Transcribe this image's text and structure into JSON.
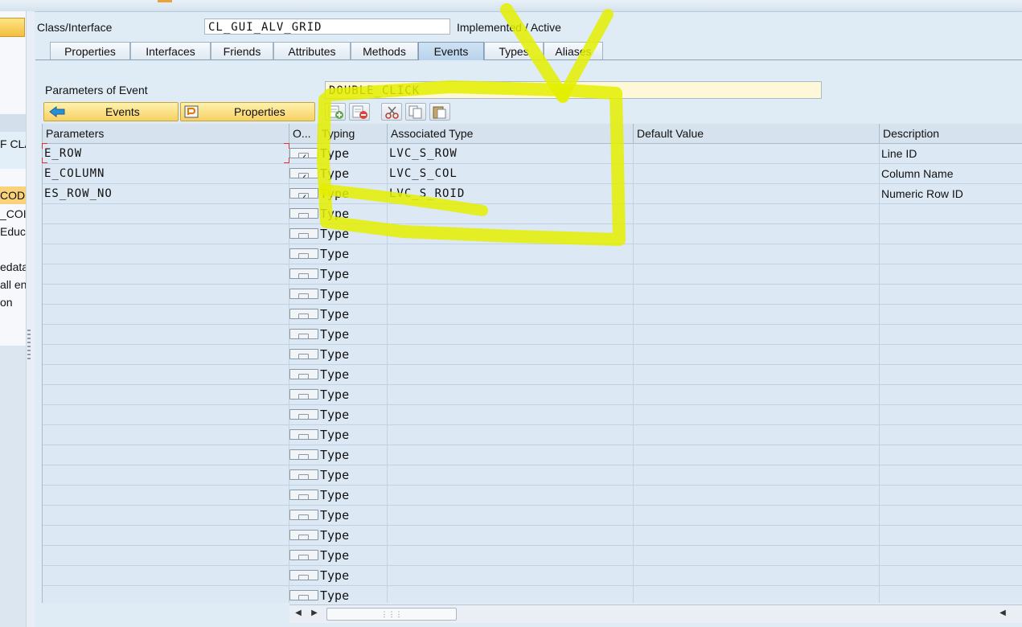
{
  "header": {
    "class_label": "Class/Interface",
    "class_value": "CL_GUI_ALV_GRID",
    "status": "Implemented / Active"
  },
  "left_panel": {
    "rows": [
      "F CLA",
      "CODE",
      "_COI",
      "Educa",
      "edata",
      "all en",
      "on"
    ]
  },
  "tabs": [
    {
      "label": "Properties"
    },
    {
      "label": "Interfaces"
    },
    {
      "label": "Friends"
    },
    {
      "label": "Attributes"
    },
    {
      "label": "Methods"
    },
    {
      "label": "Events"
    },
    {
      "label": "Types"
    },
    {
      "label": "Aliases"
    }
  ],
  "active_tab": "Events",
  "event": {
    "label": "Parameters of Event",
    "value": "DOUBLE_CLICK"
  },
  "toolbar": {
    "events_button": "Events",
    "properties_button": "Properties",
    "icons": [
      "insert-row-icon",
      "delete-row-icon",
      "cut-icon",
      "copy-icon",
      "paste-icon"
    ]
  },
  "grid": {
    "columns": [
      "Parameters",
      "O...",
      "Typing",
      "Associated Type",
      "Default Value",
      "Description"
    ],
    "rows": [
      {
        "param": "E_ROW",
        "optional": true,
        "typing": "Type",
        "assoc": "LVC_S_ROW",
        "default": "",
        "desc": "Line ID"
      },
      {
        "param": "E_COLUMN",
        "optional": true,
        "typing": "Type",
        "assoc": "LVC_S_COL",
        "default": "",
        "desc": "Column Name"
      },
      {
        "param": "ES_ROW_NO",
        "optional": true,
        "typing": "Type",
        "assoc": "LVC_S_ROID",
        "default": "",
        "desc": "Numeric Row ID"
      }
    ],
    "empty_row_typing": "Type",
    "empty_row_count": 20
  },
  "colors": {
    "highlight_annotation": "#e6ee00",
    "yellow_button": "#f6d164",
    "active_tab": "#b8d3ec"
  }
}
